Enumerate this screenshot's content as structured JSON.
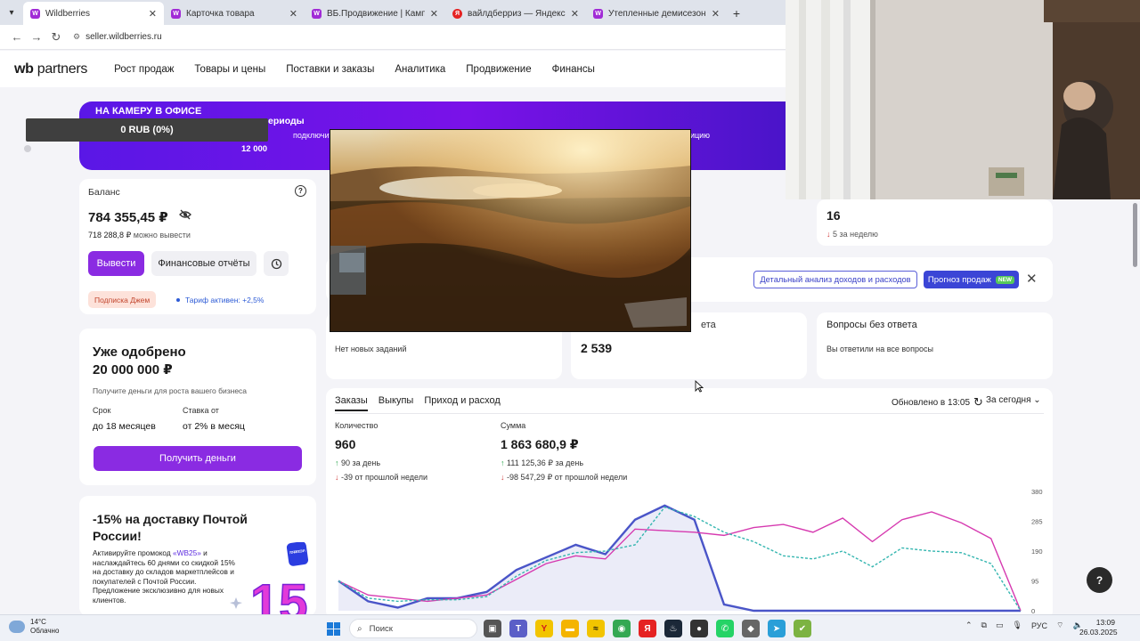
{
  "browser": {
    "tabs": [
      {
        "title": "Wildberries",
        "favicon": "W",
        "active": true
      },
      {
        "title": "Карточка товара",
        "favicon": "W",
        "active": false
      },
      {
        "title": "ВБ.Продвижение | Кампании",
        "favicon": "W",
        "active": false
      },
      {
        "title": "вайлдберриз — Яндекс: нашл",
        "favicon": "Я",
        "active": false
      },
      {
        "title": "Утепленные демисезонные кр",
        "favicon": "W",
        "active": false
      }
    ],
    "url": "seller.wildberries.ru"
  },
  "header": {
    "logo_bold": "wb",
    "logo_thin": "partners",
    "nav": [
      "Рост продаж",
      "Товары и цены",
      "Поставки и заказы",
      "Аналитика",
      "Продвижение",
      "Финансы"
    ]
  },
  "banner": {
    "line1": "НА КАМЕРУ В ОФИСЕ",
    "line2": "ериоды",
    "line3": "подключить на",
    "line4": "12 000",
    "line5": "ицию"
  },
  "overlay_pill": "0 RUB (0%)",
  "balance": {
    "label": "Баланс",
    "amount": "784 355,45 ₽",
    "available_amount": "718 288,8 ₽",
    "available_text": "можно вывести",
    "withdraw": "Вывести",
    "reports": "Финансовые отчёты",
    "chip_subscription": "Подписка Джем",
    "chip_tariff": "Тариф активен: +2,5%"
  },
  "loan": {
    "title_line1": "Уже одобрено",
    "title_line2": "20 000 000 ₽",
    "desc": "Получите деньги для роста вашего бизнеса",
    "term_label": "Срок",
    "term_value": "до 18 месяцев",
    "rate_label": "Ставка от",
    "rate_value": "от 2% в месяц",
    "button": "Получить деньги"
  },
  "promo": {
    "title": "-15% на доставку Почтой России!",
    "desc_pre": "Активируйте промокод ",
    "code": "«WB25»",
    "desc_post": " и наслаждайтесь 60 днями со скидкой 15% на доставку до складов маркетплейсов и покупателей с Почтой России. Предложение эксклюзивно для новых клиентов.",
    "badge_top": "ПОЧТА РОССИИ",
    "big_number": "15"
  },
  "stat_16": {
    "value": "16",
    "delta": "5",
    "delta_text": "за неделю"
  },
  "actions": {
    "detail_button": "Детальный анализ доходов и расходов",
    "forecast_button": "Прогноз продаж",
    "new_badge": "NEW"
  },
  "tasks": {
    "text": "Нет новых заданий"
  },
  "reviews": {
    "label": "ета",
    "value": "2 539"
  },
  "questions": {
    "label": "Вопросы без ответа",
    "text": "Вы ответили на все вопросы"
  },
  "orders": {
    "tabs": [
      "Заказы",
      "Выкупы",
      "Приход и расход"
    ],
    "updated": "Обновлено в 13:05",
    "period": "За сегодня",
    "qty_label": "Количество",
    "qty_value": "960",
    "qty_day": "90",
    "qty_day_text": "за день",
    "qty_week": "-39",
    "qty_week_text": "от прошлой недели",
    "sum_label": "Сумма",
    "sum_value": "1 863 680,9 ₽",
    "sum_day": "111 125,36 ₽",
    "sum_day_text": "за день",
    "sum_week": "-98 547,29 ₽",
    "sum_week_text": "от прошлой недели"
  },
  "chart_data": {
    "type": "line",
    "ylim": [
      0,
      380
    ],
    "yticks": [
      "380",
      "285",
      "190",
      "95",
      "0"
    ],
    "series": [
      {
        "color": "#4a55c8",
        "values": [
          95,
          30,
          10,
          40,
          40,
          60,
          130,
          170,
          210,
          180,
          290,
          335,
          290,
          20,
          0,
          0,
          0,
          0,
          0,
          0,
          0,
          0,
          0,
          0
        ]
      },
      {
        "color": "#d63ab0",
        "values": [
          95,
          50,
          40,
          30,
          40,
          50,
          100,
          150,
          175,
          165,
          260,
          255,
          250,
          240,
          265,
          275,
          250,
          295,
          220,
          290,
          315,
          280,
          230,
          0
        ]
      },
      {
        "color": "#35b6b0",
        "values": [
          95,
          40,
          30,
          35,
          35,
          45,
          110,
          160,
          185,
          190,
          210,
          330,
          300,
          250,
          220,
          175,
          165,
          190,
          140,
          200,
          190,
          185,
          150,
          0
        ]
      }
    ]
  },
  "help_fab": "?",
  "taskbar": {
    "temp": "14°C",
    "weather": "Облачно",
    "search": "Поиск",
    "lang": "РУС",
    "time": "13:09",
    "date": "26.03.2025"
  },
  "colors": {
    "brand": "#8a2be2",
    "accent_blue": "#3b45d6"
  }
}
